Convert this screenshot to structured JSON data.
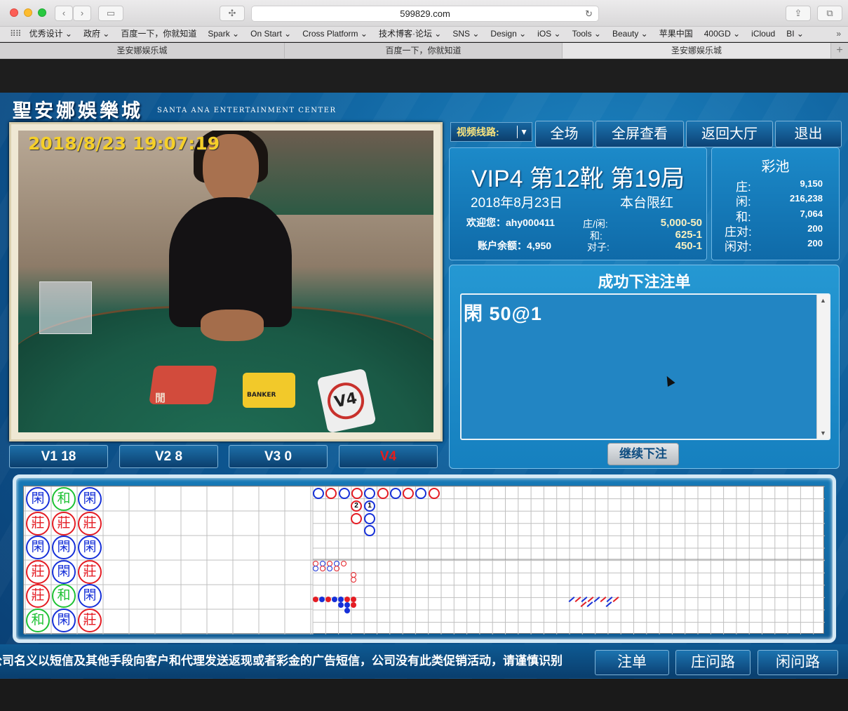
{
  "browser": {
    "url": "599829.com",
    "bookmarks": [
      "优秀设计 ⌄",
      "政府 ⌄",
      "百度一下，你就知道",
      "Spark ⌄",
      "On Start ⌄",
      "Cross Platform ⌄",
      "技术博客·论坛 ⌄",
      "SNS ⌄",
      "Design ⌄",
      "iOS ⌄",
      "Tools ⌄",
      "Beauty ⌄",
      "苹果中国",
      "400GD ⌄",
      "iCloud",
      "BI ⌄"
    ],
    "tabs": [
      "圣安娜娱乐城",
      "百度一下，你就知道",
      "圣安娜娱乐城"
    ]
  },
  "brand": {
    "name": "聖安娜娛樂城",
    "name_en": "SANTA ANA ENTERTAINMENT CENTER"
  },
  "video": {
    "timestamp": "2018/8/23 19:07:19",
    "labels": {
      "player": "閒",
      "banker": "BANKER",
      "plaque": "V4"
    },
    "line_buttons": [
      {
        "label": "V1 18",
        "active": false
      },
      {
        "label": "V2 8",
        "active": false
      },
      {
        "label": "V3 0",
        "active": false
      },
      {
        "label": "V4",
        "active": true
      }
    ]
  },
  "toolbar": {
    "route_select": "视频线路:",
    "buttons": [
      "全场",
      "全屏查看",
      "返回大厅",
      "退出"
    ]
  },
  "table_info": {
    "title": "VIP4 第12靴 第19局",
    "date": "2018年8月23日",
    "limit_heading": "本台限红",
    "welcome_label": "欢迎您：",
    "username": "ahy000411",
    "balance_label": "账户余额：",
    "balance": "4,950",
    "limits": [
      {
        "label": "庄/闲:",
        "value": "5,000-50"
      },
      {
        "label": "和:",
        "value": "625-1"
      },
      {
        "label": "对子:",
        "value": "450-1"
      }
    ]
  },
  "pool": {
    "title": "彩池",
    "rows": [
      {
        "label": "庄:",
        "value": "9,150"
      },
      {
        "label": "闲:",
        "value": "216,238"
      },
      {
        "label": "和:",
        "value": "7,064"
      },
      {
        "label": "庄对:",
        "value": "200"
      },
      {
        "label": "闲对:",
        "value": "200"
      }
    ]
  },
  "bet_panel": {
    "title": "成功下注注单",
    "entries": [
      "閑  50@1"
    ],
    "continue_button": "继续下注"
  },
  "bead_road": [
    [
      "閑",
      "莊",
      "閑",
      "莊",
      "莊",
      "和"
    ],
    [
      "和",
      "莊",
      "閑",
      "閑",
      "和",
      "閑"
    ],
    [
      "閑",
      "莊",
      "閑",
      "莊",
      "閑",
      "莊"
    ]
  ],
  "big_road_marks": [
    "2",
    "1"
  ],
  "colors": {
    "banker": "#e41d24",
    "player": "#1630d8",
    "tie": "#1ec234"
  },
  "footer": {
    "marquee": "冒用公司名义以短信及其他手段向客户和代理发送返现或者彩金的广告短信，公司没有此类促销活动，请谨慎识别",
    "buttons": [
      "注单",
      "庄问路",
      "闲问路"
    ]
  }
}
